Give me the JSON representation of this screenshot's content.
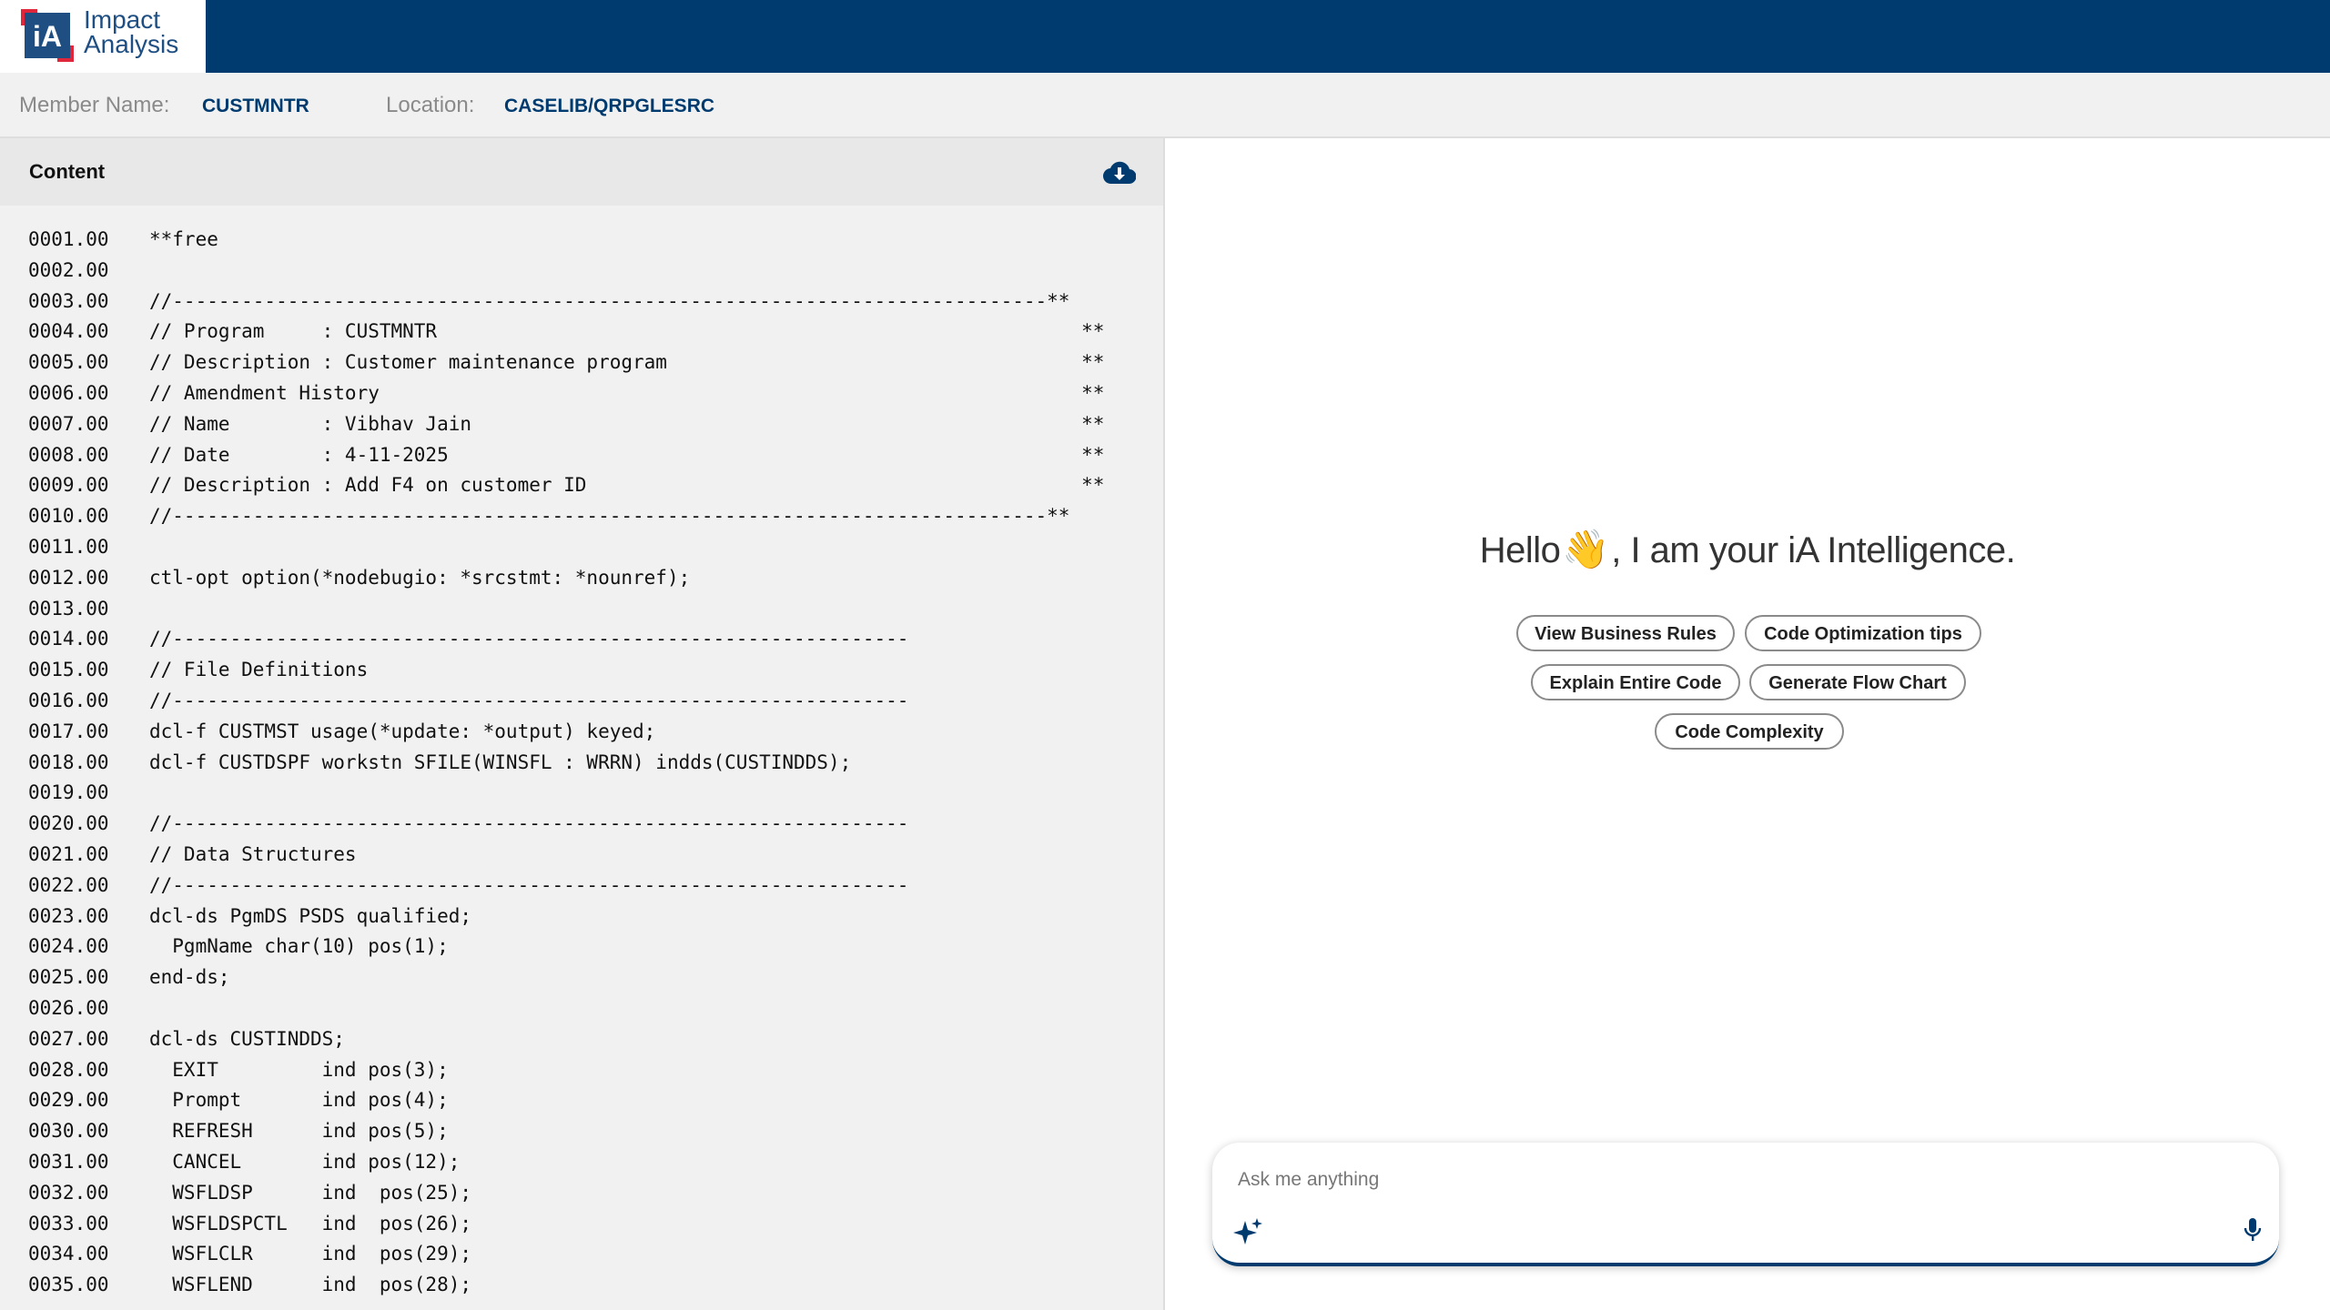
{
  "app": {
    "logo_mark": "iA",
    "logo_line1": "Impact",
    "logo_line2": "Analysis"
  },
  "member": {
    "name_label": "Member Name:",
    "name_value": "CUSTMNTR",
    "location_label": "Location:",
    "location_value": "CASELIB/QRPGLESRC"
  },
  "content": {
    "title": "Content",
    "download_icon": "cloud-download-icon",
    "lines": [
      {
        "num": "0001.00",
        "text": "**free"
      },
      {
        "num": "0002.00",
        "text": ""
      },
      {
        "num": "0003.00",
        "text": "//----------------------------------------------------------------------------**"
      },
      {
        "num": "0004.00",
        "text": "// Program     : CUSTMNTR                                                        **"
      },
      {
        "num": "0005.00",
        "text": "// Description : Customer maintenance program                                    **"
      },
      {
        "num": "0006.00",
        "text": "// Amendment History                                                             **"
      },
      {
        "num": "0007.00",
        "text": "// Name        : Vibhav Jain                                                     **"
      },
      {
        "num": "0008.00",
        "text": "// Date        : 4-11-2025                                                       **"
      },
      {
        "num": "0009.00",
        "text": "// Description : Add F4 on customer ID                                           **"
      },
      {
        "num": "0010.00",
        "text": "//----------------------------------------------------------------------------**"
      },
      {
        "num": "0011.00",
        "text": ""
      },
      {
        "num": "0012.00",
        "text": "ctl-opt option(*nodebugio: *srcstmt: *nounref);"
      },
      {
        "num": "0013.00",
        "text": ""
      },
      {
        "num": "0014.00",
        "text": "//----------------------------------------------------------------"
      },
      {
        "num": "0015.00",
        "text": "// File Definitions"
      },
      {
        "num": "0016.00",
        "text": "//----------------------------------------------------------------"
      },
      {
        "num": "0017.00",
        "text": "dcl-f CUSTMST usage(*update: *output) keyed;"
      },
      {
        "num": "0018.00",
        "text": "dcl-f CUSTDSPF workstn SFILE(WINSFL : WRRN) indds(CUSTINDDS);"
      },
      {
        "num": "0019.00",
        "text": ""
      },
      {
        "num": "0020.00",
        "text": "//----------------------------------------------------------------"
      },
      {
        "num": "0021.00",
        "text": "// Data Structures"
      },
      {
        "num": "0022.00",
        "text": "//----------------------------------------------------------------"
      },
      {
        "num": "0023.00",
        "text": "dcl-ds PgmDS PSDS qualified;"
      },
      {
        "num": "0024.00",
        "text": "  PgmName char(10) pos(1);"
      },
      {
        "num": "0025.00",
        "text": "end-ds;"
      },
      {
        "num": "0026.00",
        "text": ""
      },
      {
        "num": "0027.00",
        "text": "dcl-ds CUSTINDDS;"
      },
      {
        "num": "0028.00",
        "text": "  EXIT         ind pos(3);"
      },
      {
        "num": "0029.00",
        "text": "  Prompt       ind pos(4);"
      },
      {
        "num": "0030.00",
        "text": "  REFRESH      ind pos(5);"
      },
      {
        "num": "0031.00",
        "text": "  CANCEL       ind pos(12);"
      },
      {
        "num": "0032.00",
        "text": "  WSFLDSP      ind  pos(25);"
      },
      {
        "num": "0033.00",
        "text": "  WSFLDSPCTL   ind  pos(26);"
      },
      {
        "num": "0034.00",
        "text": "  WSFLCLR      ind  pos(29);"
      },
      {
        "num": "0035.00",
        "text": "  WSFLEND      ind  pos(28);"
      }
    ]
  },
  "assistant": {
    "greeting_before": "Hello",
    "greeting_emoji": "👋",
    "greeting_after": ", I am your iA Intelligence.",
    "actions": [
      "View Business Rules",
      "Code Optimization tips",
      "Explain Entire Code",
      "Generate Flow Chart",
      "Code Complexity"
    ],
    "input_placeholder": "Ask me anything",
    "sparkle_icon": "sparkle-icon",
    "mic_icon": "microphone-icon"
  },
  "colors": {
    "brand_navy": "#003b6f",
    "logo_red": "#e0263a",
    "panel_gray": "#f1f1f1"
  }
}
